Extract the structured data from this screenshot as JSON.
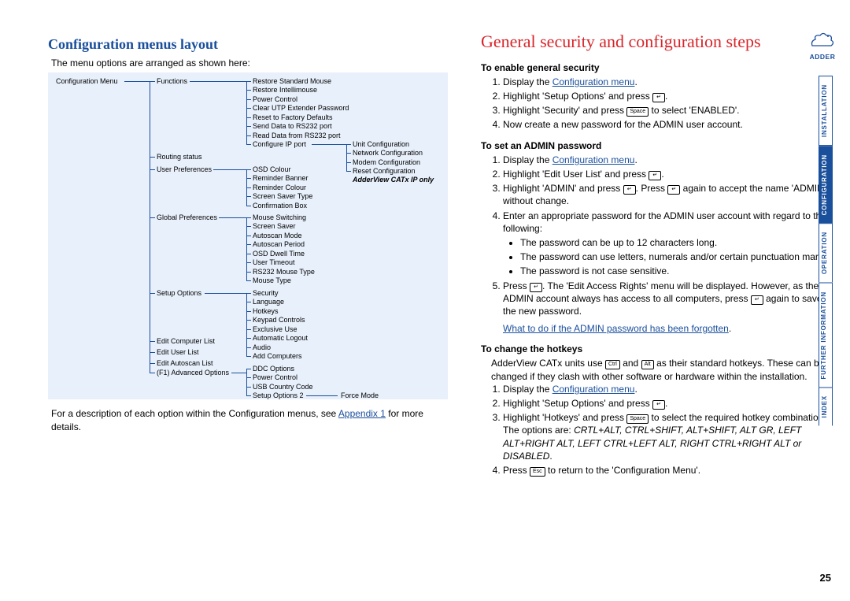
{
  "left_heading": "Configuration menus layout",
  "left_intro": "The menu options are arranged as shown here:",
  "diagram": {
    "root": "Configuration Menu",
    "col2": [
      "Functions",
      "Routing status",
      "User Preferences",
      "Global Preferences",
      "Setup Options",
      "Edit Computer List",
      "Edit User List",
      "Edit Autoscan List",
      "(F1) Advanced Options"
    ],
    "functions_items": [
      "Restore Standard Mouse",
      "Restore Intellimouse",
      "Power Control",
      "Clear UTP Extender Password",
      "Reset to Factory Defaults",
      "Send Data to RS232 port",
      "Read Data from RS232 port",
      "Configure IP port"
    ],
    "ip_items": [
      "Unit Configuration",
      "Network Configuration",
      "Modem Configuration",
      "Reset Configuration"
    ],
    "ip_note": "AdderView CATx IP only",
    "user_pref_items": [
      "OSD Colour",
      "Reminder Banner",
      "Reminder Colour",
      "Screen Saver Type",
      "Confirmation Box"
    ],
    "global_pref_items": [
      "Mouse Switching",
      "Screen Saver",
      "Autoscan Mode",
      "Autoscan Period",
      "OSD Dwell Time",
      "User Timeout",
      "RS232 Mouse Type",
      "Mouse Type"
    ],
    "setup_items": [
      "Security",
      "Language",
      "Hotkeys",
      "Keypad Controls",
      "Exclusive Use",
      "Automatic Logout",
      "Audio",
      "Add Computers"
    ],
    "adv_items": [
      "DDC Options",
      "Power Control",
      "USB Country Code",
      "Setup Options 2"
    ],
    "adv_sub": "Force Mode"
  },
  "after_diagram_1": "For a description of each option within the Configuration menus, see ",
  "after_diagram_link": "Appendix 1",
  "after_diagram_2": " for more details.",
  "right_heading": "General security and configuration steps",
  "sec1_head": "To enable general security",
  "sec1_steps": {
    "s1a": "Display the ",
    "s1b": "Configuration menu",
    "s1c": ".",
    "s2a": "Highlight 'Setup Options' and press ",
    "s2c": ".",
    "s3a": "Highlight 'Security' and press ",
    "s3b": " to select 'ENABLED'.",
    "s4": "Now create a new password for the ADMIN user account."
  },
  "sec2_head": "To set an ADMIN password",
  "sec2_steps": {
    "s1a": "Display the ",
    "s1b": "Configuration menu",
    "s1c": ".",
    "s2a": "Highlight 'Edit User List' and press ",
    "s2c": ".",
    "s3a": "Highlight 'ADMIN' and press ",
    "s3b": ". Press ",
    "s3c": " again to accept the name 'ADMIN' without change.",
    "s4": "Enter an appropriate password for the ADMIN user account with regard to the following:",
    "b1": "The password can be up to 12 characters long.",
    "b2": "The password can use letters, numerals and/or certain punctuation marks.",
    "b3": "The password is not case sensitive.",
    "s5a": "Press ",
    "s5b": ". The 'Edit Access Rights' menu will be displayed. However, as the ADMIN account always has access to all computers, press ",
    "s5c": " again to save the new password."
  },
  "forgot_link": "What to do if the ADMIN password has been forgotten",
  "sec3_head": "To change the hotkeys",
  "sec3_intro_a": "AdderView CATx units use ",
  "sec3_intro_b": " and ",
  "sec3_intro_c": " as their standard hotkeys. These can be changed if they clash with other software or hardware within the installation.",
  "sec3_steps": {
    "s1a": "Display the ",
    "s1b": "Configuration menu",
    "s1c": ".",
    "s2a": "Highlight 'Setup Options' and press ",
    "s2c": ".",
    "s3a": "Highlight 'Hotkeys' and press ",
    "s3b": " to select the required hotkey combination. The options are: ",
    "s3c": "CRTL+ALT, CTRL+SHIFT, ALT+SHIFT, ALT GR, LEFT ALT+RIGHT ALT, LEFT CTRL+LEFT ALT, RIGHT CTRL+RIGHT ALT or DISABLED",
    "s3d": ".",
    "s4a": "Press ",
    "s4b": " to return to the 'Configuration Menu'."
  },
  "keys": {
    "enter": "↵",
    "space": "Space",
    "ctrl": "Ctrl",
    "alt": "Alt",
    "esc": "Esc"
  },
  "tabs": [
    "INSTALLATION",
    "CONFIGURATION",
    "OPERATION",
    "FURTHER\nINFORMATION",
    "INDEX"
  ],
  "logo_text": "ADDER",
  "page_number": "25"
}
